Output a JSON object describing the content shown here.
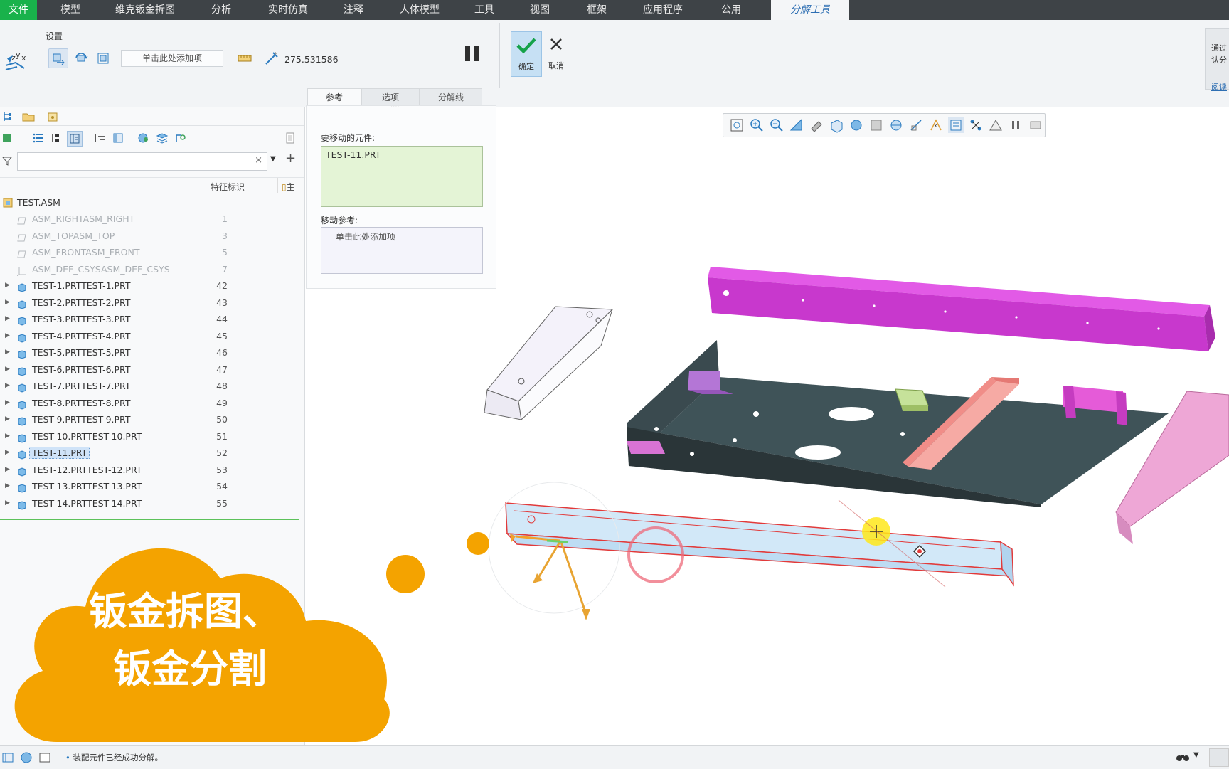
{
  "menubar": {
    "items": [
      "文件",
      "模型",
      "维克钣金拆图",
      "分析",
      "实时仿真",
      "注释",
      "人体模型",
      "工具",
      "视图",
      "框架",
      "应用程序",
      "公用",
      "分解工具"
    ],
    "active_index": 12
  },
  "ribbon": {
    "settings_label": "设置",
    "add_item_hint": "单击此处添加项",
    "value": "275.531586",
    "confirm_label": "确定",
    "cancel_label": "取消",
    "tabs": [
      "参考",
      "选项",
      "分解线"
    ],
    "right_fragment_1": "通过",
    "right_fragment_2": "认分",
    "right_fragment_3": "阅读"
  },
  "reference_panel": {
    "components_label": "要移动的元件:",
    "component_value": "TEST-11.PRT",
    "move_ref_label": "移动参考:",
    "move_ref_hint": "单击此处添加项"
  },
  "model_tree": {
    "column_header": "特征标识",
    "column_header_2": "主",
    "root": "TEST.ASM",
    "items": [
      {
        "name": "ASM_RIGHT",
        "id": "1",
        "kind": "datum"
      },
      {
        "name": "ASM_TOP",
        "id": "3",
        "kind": "datum"
      },
      {
        "name": "ASM_FRONT",
        "id": "5",
        "kind": "datum"
      },
      {
        "name": "ASM_DEF_CSYS",
        "id": "7",
        "kind": "csys"
      },
      {
        "name": "TEST-1.PRT",
        "id": "42",
        "kind": "part"
      },
      {
        "name": "TEST-2.PRT",
        "id": "43",
        "kind": "part"
      },
      {
        "name": "TEST-3.PRT",
        "id": "44",
        "kind": "part"
      },
      {
        "name": "TEST-4.PRT",
        "id": "45",
        "kind": "part"
      },
      {
        "name": "TEST-5.PRT",
        "id": "46",
        "kind": "part"
      },
      {
        "name": "TEST-6.PRT",
        "id": "47",
        "kind": "part"
      },
      {
        "name": "TEST-7.PRT",
        "id": "48",
        "kind": "part"
      },
      {
        "name": "TEST-8.PRT",
        "id": "49",
        "kind": "part"
      },
      {
        "name": "TEST-9.PRT",
        "id": "50",
        "kind": "part"
      },
      {
        "name": "TEST-10.PRT",
        "id": "51",
        "kind": "part"
      },
      {
        "name": "TEST-11.PRT",
        "id": "52",
        "kind": "part",
        "selected": true
      },
      {
        "name": "TEST-12.PRT",
        "id": "53",
        "kind": "part"
      },
      {
        "name": "TEST-13.PRT",
        "id": "54",
        "kind": "part"
      },
      {
        "name": "TEST-14.PRT",
        "id": "55",
        "kind": "part"
      }
    ]
  },
  "overlay": {
    "line1": "钣金拆图、",
    "line2": "钣金分割"
  },
  "status": {
    "message": "装配元件已经成功分解。"
  },
  "colors": {
    "menubar_bg": "#3e4347",
    "accent_green": "#19b24b",
    "overlay_orange": "#f4a300",
    "magenta_part": "#d23ad8",
    "selected_part": "#cfe6f7"
  }
}
